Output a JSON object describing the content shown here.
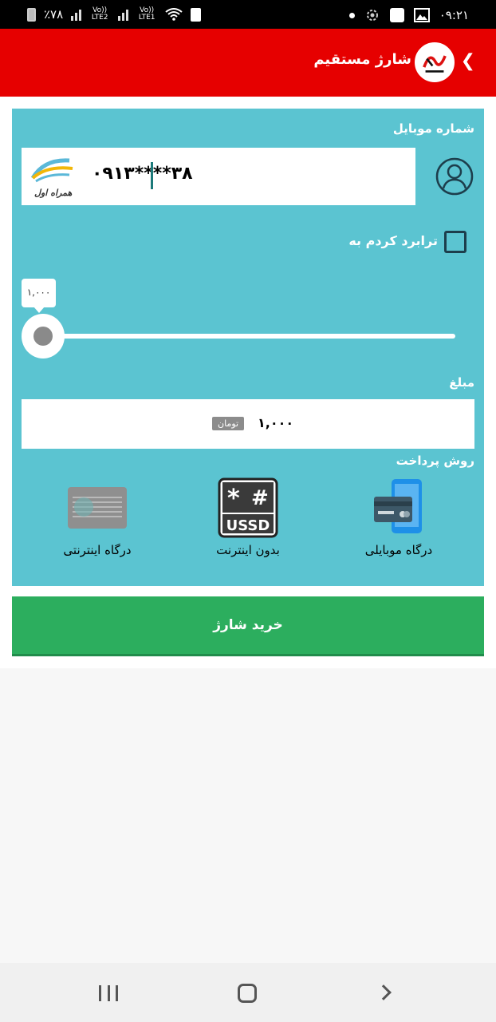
{
  "status_bar": {
    "battery": "٪۷۸",
    "carrier1": "Vo)) LTE2",
    "carrier2": "Vo)) LTE1",
    "time": "۰۹:۲۱"
  },
  "header": {
    "title": "شارژ مستقیم",
    "back_icon": "chevron-left-icon",
    "background": "#e60000"
  },
  "form": {
    "mobile_label": "شماره موبایل",
    "phone_number": "۰۹۱۳****۳۸",
    "operator": "همراه اول",
    "checkbox_label": "ترابرد کردم به",
    "checkbox_checked": false,
    "slider_value": "۱,۰۰۰",
    "slider_fraction": 0,
    "amount_label": "مبلغ",
    "amount_value": "۱,۰۰۰",
    "currency": "تومان",
    "payment_label": "روش پرداخت",
    "payment_methods": [
      {
        "label": "درگاه موبایلی",
        "icon": "mobile-card-icon"
      },
      {
        "label": "بدون اینترنت",
        "icon": "ussd-icon",
        "icon_text": "USSD"
      },
      {
        "label": "درگاه اینترنتی",
        "icon": "bank-card-icon"
      }
    ]
  },
  "buy_button": {
    "label": "خرید شارژ",
    "color": "#2cae5e"
  },
  "colors": {
    "card_bg": "#5bc4d1"
  }
}
